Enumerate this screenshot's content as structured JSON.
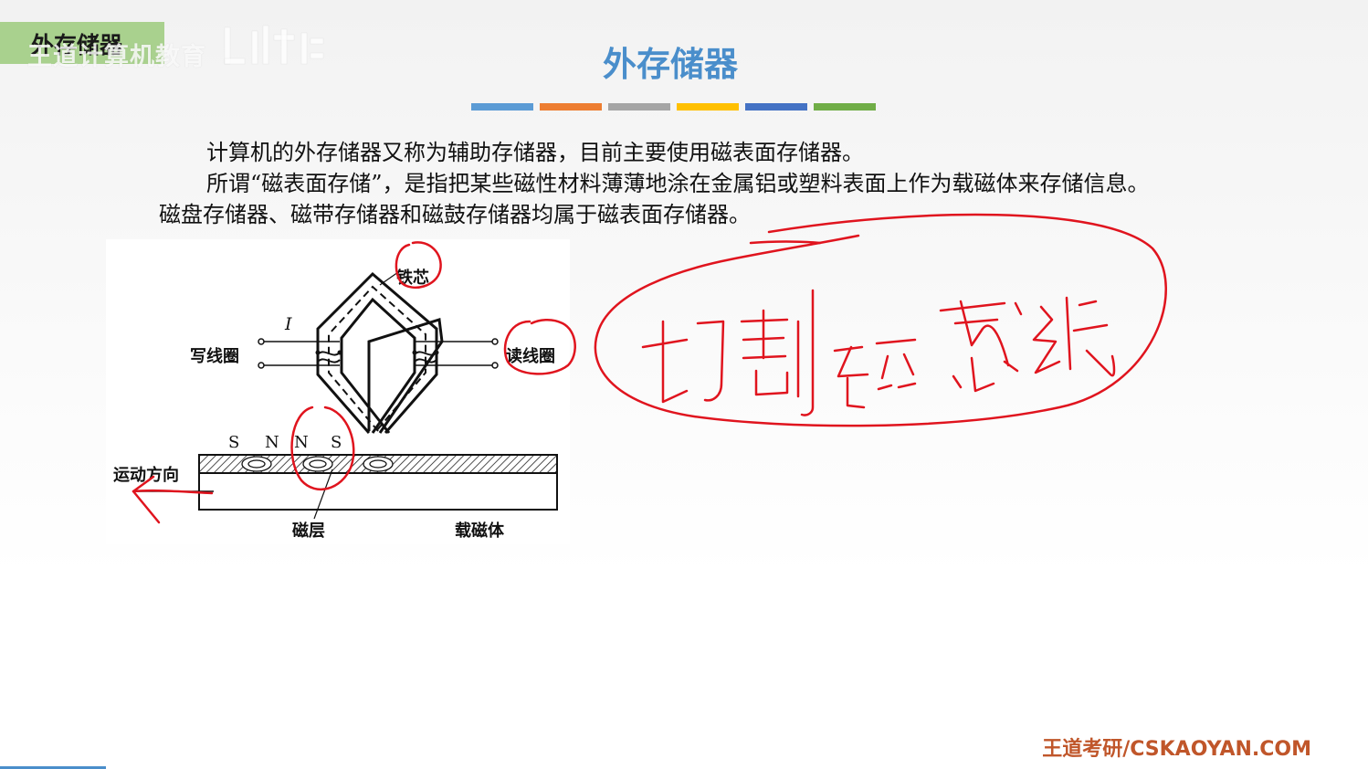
{
  "header": {
    "corner_tag": "外存储器",
    "watermark": "王道计算机教育",
    "title": "外存储器",
    "color_bars": [
      "#5b9bd5",
      "#ed7d31",
      "#a5a5a5",
      "#ffc000",
      "#4472c4",
      "#70ad47"
    ]
  },
  "body": {
    "paragraph_1": "计算机的外存储器又称为辅助存储器，目前主要使用磁表面存储器。",
    "paragraph_2": "所谓“磁表面存储”，是指把某些磁性材料薄薄地涂在金属铝或塑料表面上作为载磁体来存储信息。磁盘存储器、磁带存储器和磁鼓存储器均属于磁表面存储器。"
  },
  "figure": {
    "iron_core_label": "铁芯",
    "current_label": "I",
    "write_coil_label": "写线圈",
    "read_coil_label": "读线圈",
    "poles": [
      "S",
      "N",
      "N",
      "S"
    ],
    "motion_label": "运动方向",
    "magnetic_layer_label": "磁层",
    "carrier_label": "载磁体"
  },
  "annotations": {
    "handwritten_note": "切割磁感线",
    "ink_color": "#e0141e"
  },
  "footer": {
    "brand": "王道考研/CSKAOYAN.COM"
  }
}
